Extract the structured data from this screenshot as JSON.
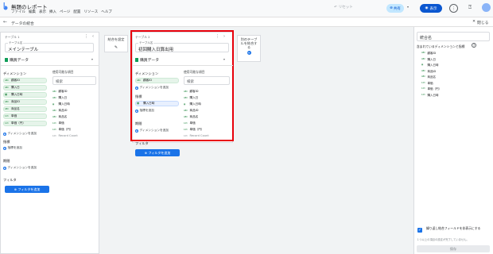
{
  "app": {
    "title": "無題のレポート",
    "menu": [
      "ファイル",
      "編集",
      "表示",
      "挿入",
      "ページ",
      "配置",
      "リソース",
      "ヘルプ"
    ],
    "reset_label": "リセット",
    "share_label": "共有",
    "view_label": "表示"
  },
  "subheader": {
    "title": "データの統合",
    "close_label": "閉じる"
  },
  "table1": {
    "tag": "テーブル 1",
    "name_caption": "テーブル名",
    "name": "メインテーブル",
    "source": "購買データ",
    "dimensions_header": "ディメンション",
    "dimension_chips": [
      {
        "label": "顧客ID",
        "type": "text"
      },
      {
        "label": "購入日",
        "type": "text"
      },
      {
        "label": "購入日時",
        "type": "date"
      },
      {
        "label": "商品ID",
        "type": "text"
      },
      {
        "label": "商品名",
        "type": "text"
      },
      {
        "label": "単価",
        "type": "num"
      },
      {
        "label": "単価（円）",
        "type": "num"
      }
    ],
    "add_dimension": "ディメンションを追加",
    "metrics_header": "指標",
    "add_metric": "指標を追加",
    "date_range_header": "期間",
    "add_date_dimension": "ディメンションを追加",
    "filter_header": "フィルタ",
    "filter_button": "フィルタを追加",
    "available_header": "使用可能な項目",
    "search_placeholder": "検索",
    "available_fields": [
      {
        "label": "顧客ID",
        "type": "ABC"
      },
      {
        "label": "購入日",
        "type": "ABC"
      },
      {
        "label": "購入日時",
        "type": "▦"
      },
      {
        "label": "商品ID",
        "type": "ABC"
      },
      {
        "label": "商品名",
        "type": "ABC"
      },
      {
        "label": "単価",
        "type": "123"
      },
      {
        "label": "単価（円）",
        "type": "123"
      },
      {
        "label": "Record Count",
        "type": "123"
      }
    ]
  },
  "join_config": {
    "label": "結合を設定"
  },
  "table2": {
    "tag": "テーブル 2",
    "name_caption": "テーブル名",
    "name": "初回購入日算出用",
    "source": "購買データ",
    "dimensions_header": "ディメンション",
    "dimension_chips": [
      {
        "label": "顧客ID",
        "type": "text"
      }
    ],
    "add_dimension": "ディメンションを追加",
    "metrics_header": "指標",
    "metric_chips": [
      {
        "label": "購入日時",
        "type": "metric"
      }
    ],
    "add_metric": "指標を追加",
    "date_range_header": "期間",
    "add_date_dimension": "ディメンションを追加",
    "filter_header": "フィルタ",
    "filter_button": "フィルタを追加",
    "available_header": "使用可能な項目",
    "search_placeholder": "検索",
    "available_fields": [
      {
        "label": "顧客ID",
        "type": "ABC"
      },
      {
        "label": "購入日",
        "type": "ABC"
      },
      {
        "label": "購入日時",
        "type": "▦"
      },
      {
        "label": "商品ID",
        "type": "ABC"
      },
      {
        "label": "商品名",
        "type": "ABC"
      },
      {
        "label": "単価",
        "type": "123"
      },
      {
        "label": "単価（円）",
        "type": "123"
      },
      {
        "label": "Record Count",
        "type": "123"
      }
    ]
  },
  "add_table": {
    "label": "別のテーブルを結合する"
  },
  "right_panel": {
    "name_placeholder": "統合名",
    "header": "含まれているディメンションと指標",
    "fields": [
      {
        "label": "顧客ID",
        "type": "ABC"
      },
      {
        "label": "購入日",
        "type": "ABC"
      },
      {
        "label": "購入日時",
        "type": "▦"
      },
      {
        "label": "商品ID",
        "type": "ABC"
      },
      {
        "label": "商品名",
        "type": "ABC"
      },
      {
        "label": "単価",
        "type": "123"
      },
      {
        "label": "単価（円）",
        "type": "123"
      },
      {
        "label": "購入日時",
        "type": "123"
      }
    ],
    "checkbox_label": "繰り返し結合フィールドを非表示にする",
    "note": "１つ以上の項目の設定が完了していません。",
    "save_label": "保存"
  }
}
